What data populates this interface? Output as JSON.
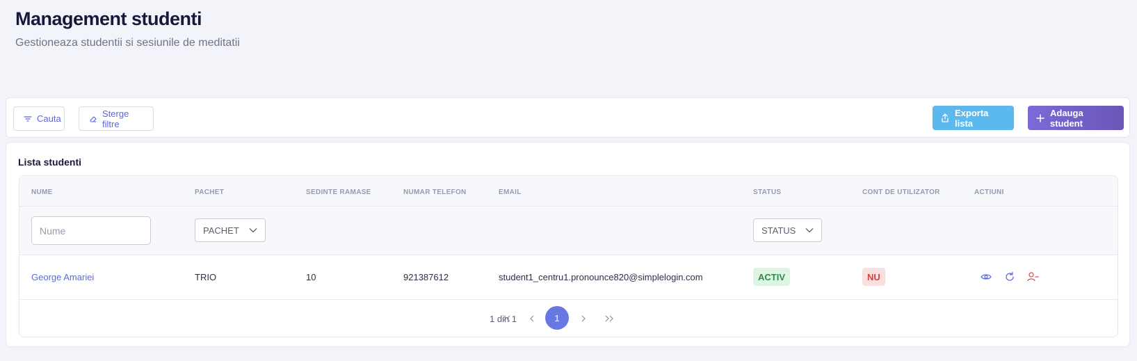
{
  "header": {
    "title": "Management studenti",
    "subtitle": "Gestioneaza studentii si sesiunile de meditatii"
  },
  "toolbar": {
    "search_label": "Cauta",
    "clear_label": "Sterge filtre",
    "export_label": "Exporta lista",
    "add_label": "Adauga student",
    "icons": {
      "search": "filter-lines-icon",
      "clear": "eraser-icon",
      "export": "upload-icon",
      "add": "plus-icon"
    },
    "colors": {
      "export": "#5bb9f0",
      "add": "#7a6bd8"
    }
  },
  "card": {
    "title": "Lista studenti"
  },
  "table": {
    "columns": [
      "NUME",
      "PACHET",
      "SEDINTE RAMASE",
      "NUMAR TELEFON",
      "EMAIL",
      "STATUS",
      "CONT DE UTILIZATOR",
      "ACTIUNI"
    ],
    "filters": {
      "name_placeholder": "Nume",
      "package_value": "PACHET",
      "status_value": "STATUS"
    },
    "rows": [
      {
        "name": "George Amariei",
        "package": "TRIO",
        "sessions_left": "10",
        "phone": "921387612",
        "email": "student1_centru1.pronounce820@simplelogin.com",
        "status": "ACTIV",
        "user_account": "NU",
        "actions": [
          "eye-icon",
          "refresh-icon",
          "remove-user-icon"
        ]
      }
    ]
  },
  "pagination": {
    "info": "1 din 1",
    "current_page": "1",
    "controls": [
      "first-page-icon",
      "prev-page-icon",
      "next-page-icon",
      "last-page-icon"
    ]
  }
}
